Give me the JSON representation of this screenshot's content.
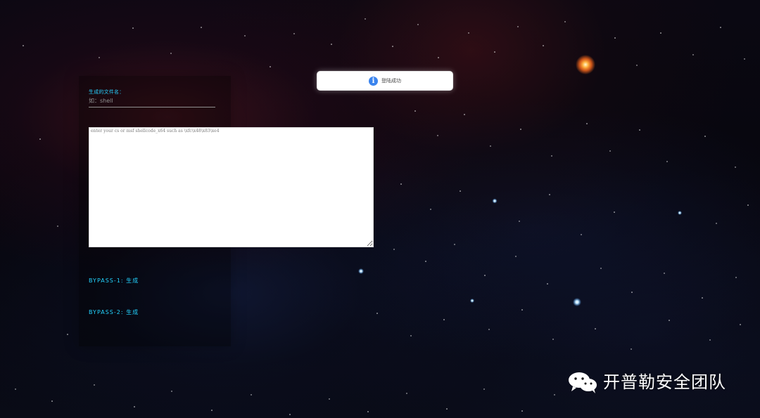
{
  "form": {
    "filename_label": "生成的文件名：",
    "filename_value": "",
    "filename_placeholder": "如：shell",
    "shellcode_value": "",
    "shellcode_placeholder": "enter your cs or msf shellcode_x64 such as \\xfc\\x48\\x83\\xe4"
  },
  "actions": {
    "bypass_1_label": "BYPASS-1: 生成",
    "bypass_2_label": "BYPASS-2: 生成"
  },
  "notification": {
    "icon": "info-icon",
    "message": "登陆成功"
  },
  "watermark": {
    "logo": "wechat-icon",
    "text": "开普勒安全团队"
  },
  "colors": {
    "accent": "#23d3ff",
    "info": "#3a84ee"
  }
}
